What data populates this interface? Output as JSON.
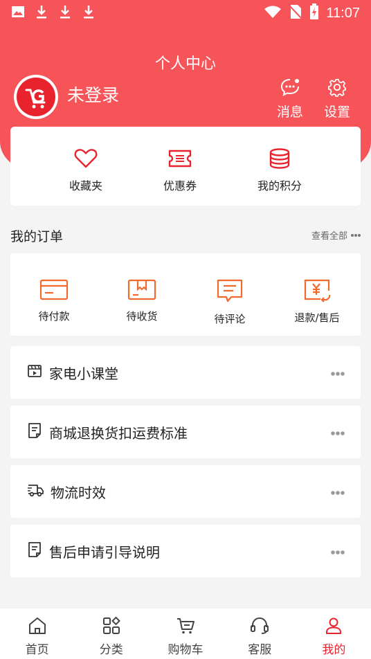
{
  "status_bar": {
    "time": "11:07"
  },
  "header": {
    "title": "个人中心",
    "login_text": "未登录",
    "messages_label": "消息",
    "settings_label": "设置"
  },
  "quick_links": [
    {
      "label": "收藏夹",
      "icon": "heart-icon"
    },
    {
      "label": "优惠券",
      "icon": "coupon-icon"
    },
    {
      "label": "我的积分",
      "icon": "coins-icon"
    }
  ],
  "orders": {
    "title": "我的订单",
    "view_all": "查看全部",
    "items": [
      {
        "label": "待付款",
        "icon": "card-icon"
      },
      {
        "label": "待收货",
        "icon": "package-icon"
      },
      {
        "label": "待评论",
        "icon": "comment-icon"
      },
      {
        "label": "退款/售后",
        "icon": "refund-icon"
      }
    ]
  },
  "menu": [
    {
      "label": "家电小课堂",
      "icon": "video-icon"
    },
    {
      "label": "商城退换货扣运费标准",
      "icon": "document-icon"
    },
    {
      "label": "物流时效",
      "icon": "truck-icon"
    },
    {
      "label": "售后申请引导说明",
      "icon": "document-icon"
    }
  ],
  "tabbar": [
    {
      "label": "首页",
      "icon": "home-icon"
    },
    {
      "label": "分类",
      "icon": "category-icon"
    },
    {
      "label": "购物车",
      "icon": "cart-icon"
    },
    {
      "label": "客服",
      "icon": "headset-icon"
    },
    {
      "label": "我的",
      "icon": "user-icon",
      "active": true
    }
  ],
  "colors": {
    "brand": "#f7545a",
    "accent": "#e8232d",
    "order_icon": "#f06a2f"
  }
}
